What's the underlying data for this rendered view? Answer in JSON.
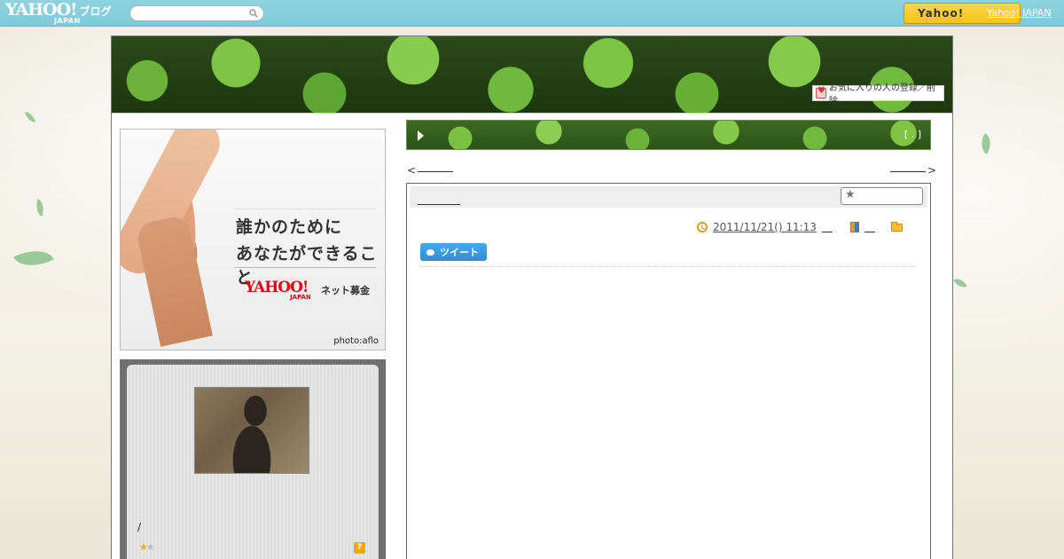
{
  "topbar": {
    "logo": "YAHOO!",
    "logo_sub": "JAPAN",
    "logo_blog": "ブログ",
    "search_placeholder": "",
    "yahoo_button": "Yahoo!",
    "yahoo_link": "Yahoo! JAPAN"
  },
  "header": {
    "favorite_label": "お気に入りの人の登録／削除"
  },
  "ad": {
    "line1": "誰かのために",
    "line2": "あなたができること",
    "logo": "YAHOO!",
    "logo_sub": "JAPAN",
    "caption": "ネット募金",
    "credit": "photo:aflo"
  },
  "profile": {
    "slash": "/",
    "help": "?"
  },
  "title_bar": {
    "bracket": "[ . ]"
  },
  "nav": {
    "prev": "<",
    "next": ">"
  },
  "article": {
    "date": "2011/11/21()  11:13",
    "tweet_label": "ツイート"
  },
  "colors": {
    "topbar": "#7fcad8",
    "yahoo_button": "#f7c21b",
    "tweet": "#2c8ed6",
    "frame_border": "#777777"
  }
}
